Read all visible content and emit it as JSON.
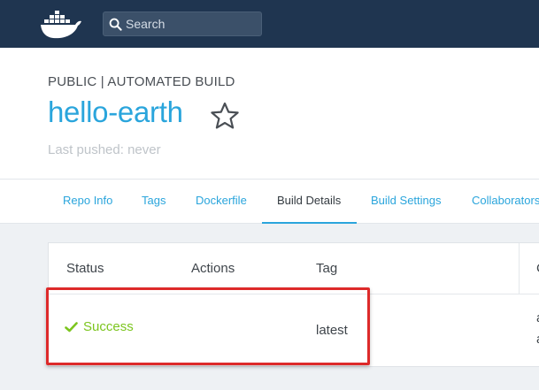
{
  "search": {
    "placeholder": "Search"
  },
  "header": {
    "repo_type": "PUBLIC | AUTOMATED BUILD",
    "repo_name": "hello-earth",
    "last_pushed": "Last pushed: never"
  },
  "tabs": [
    {
      "label": "Repo Info"
    },
    {
      "label": "Tags"
    },
    {
      "label": "Dockerfile"
    },
    {
      "label": "Build Details",
      "active": true
    },
    {
      "label": "Build Settings"
    },
    {
      "label": "Collaborators"
    }
  ],
  "table": {
    "columns": [
      "Status",
      "Actions",
      "Tag",
      "C"
    ],
    "rows": [
      {
        "status": "Success",
        "actions": "",
        "tag": "latest",
        "extra": [
          "a",
          "a"
        ]
      }
    ]
  },
  "colors": {
    "topbar": "#1f3550",
    "accent": "#2aa5dc",
    "success": "#7cc51f",
    "highlight": "#dd2a2a"
  },
  "icons": [
    "docker-whale-logo",
    "search-icon",
    "star-icon",
    "checkmark-icon"
  ]
}
